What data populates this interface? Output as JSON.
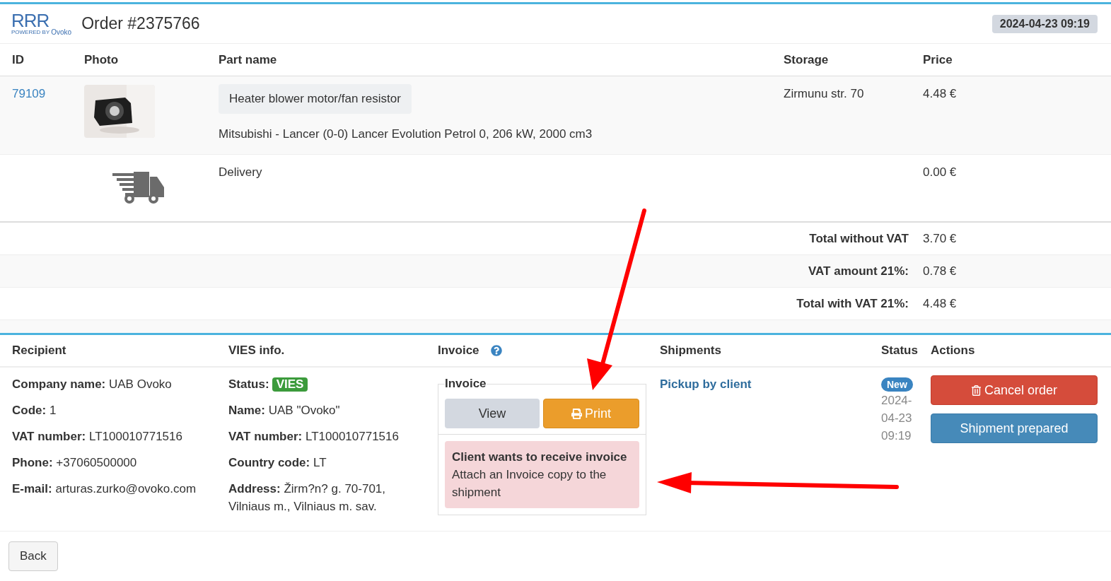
{
  "logo": {
    "mark": "RRR",
    "tagline": "POWERED BY",
    "brand": "Ovoko"
  },
  "title": "Order #2375766",
  "date": "2024-04-23 09:19",
  "table": {
    "columns": [
      "ID",
      "Photo",
      "Part name",
      "Storage",
      "Price"
    ],
    "rows": [
      {
        "kind": "part",
        "id": "79109",
        "part_name": "Heater blower motor/fan resistor",
        "description": "Mitsubishi - Lancer (0-0) Lancer Evolution Petrol 0, 206 kW, 2000 cm3",
        "storage": "Zirmunu str. 70",
        "price": "4.48 €"
      },
      {
        "kind": "delivery",
        "part_name": "Delivery",
        "price": "0.00 €"
      }
    ]
  },
  "totals": [
    {
      "label": "Total without VAT",
      "value": "3.70 €"
    },
    {
      "label": "VAT amount 21%:",
      "value": "0.78 €"
    },
    {
      "label": "Total with VAT 21%:",
      "value": "4.48 €"
    }
  ],
  "details": {
    "columns": [
      "Recipient",
      "VIES info.",
      "Invoice",
      "Shipments",
      "Status",
      "Actions"
    ],
    "recipient": [
      {
        "label": "Company name:",
        "value": "UAB Ovoko"
      },
      {
        "label": "Code:",
        "value": "1"
      },
      {
        "label": "VAT number:",
        "value": "LT100010771516"
      },
      {
        "label": "Phone:",
        "value": "+37060500000"
      },
      {
        "label": "E-mail:",
        "value": "arturas.zurko@ovoko.com"
      }
    ],
    "vies": {
      "status_label": "Status:",
      "status_badge": "VIES",
      "fields": [
        {
          "label": "Name:",
          "value": "UAB \"Ovoko\""
        },
        {
          "label": "VAT number:",
          "value": "LT100010771516"
        },
        {
          "label": "Country code:",
          "value": "LT"
        },
        {
          "label": "Address:",
          "value": "Žirm?n? g. 70-701, Vilniaus m., Vilniaus m. sav."
        }
      ]
    },
    "invoice": {
      "legend": "Invoice",
      "view_button": "View",
      "print_button": "Print",
      "alert_title": "Client wants to receive invoice",
      "alert_text": "Attach an Invoice copy to the shipment"
    },
    "shipment": "Pickup by client",
    "status": {
      "badge": "New",
      "date": "2024-04-23 09:19"
    },
    "actions": [
      {
        "kind": "danger",
        "label": "Cancel order"
      },
      {
        "kind": "primary",
        "label": "Shipment prepared"
      }
    ]
  },
  "back_button": "Back"
}
